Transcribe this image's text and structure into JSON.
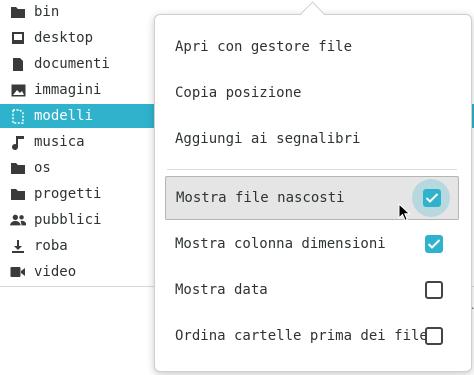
{
  "colors": {
    "accent": "#2fb3cc",
    "text": "#2e3436",
    "hover_bg": "#e5e5e5"
  },
  "folders": [
    {
      "label": "bin",
      "icon": "folder-icon",
      "selected": false
    },
    {
      "label": "desktop",
      "icon": "desktop-icon",
      "selected": false
    },
    {
      "label": "documenti",
      "icon": "document-icon",
      "selected": false
    },
    {
      "label": "immagini",
      "icon": "image-icon",
      "selected": false
    },
    {
      "label": "modelli",
      "icon": "template-icon",
      "selected": true
    },
    {
      "label": "musica",
      "icon": "music-icon",
      "selected": false
    },
    {
      "label": "os",
      "icon": "folder-icon",
      "selected": false
    },
    {
      "label": "progetti",
      "icon": "folder-icon",
      "selected": false
    },
    {
      "label": "pubblici",
      "icon": "users-icon",
      "selected": false
    },
    {
      "label": "roba",
      "icon": "download-icon",
      "selected": false
    },
    {
      "label": "video",
      "icon": "video-icon",
      "selected": false
    }
  ],
  "menu": {
    "open_with_file_manager": "Apri con gestore file",
    "copy_location": "Copia posizione",
    "add_bookmark": "Aggiungi ai segnalibri",
    "show_hidden_files": {
      "label": "Mostra file nascosti",
      "checked": true
    },
    "show_size_column": {
      "label": "Mostra colonna dimensioni",
      "checked": true
    },
    "show_date": {
      "label": "Mostra data",
      "checked": false
    },
    "sort_folders_first": {
      "label": "Ordina cartelle prima dei file",
      "checked": false
    }
  },
  "side_hint": "r"
}
